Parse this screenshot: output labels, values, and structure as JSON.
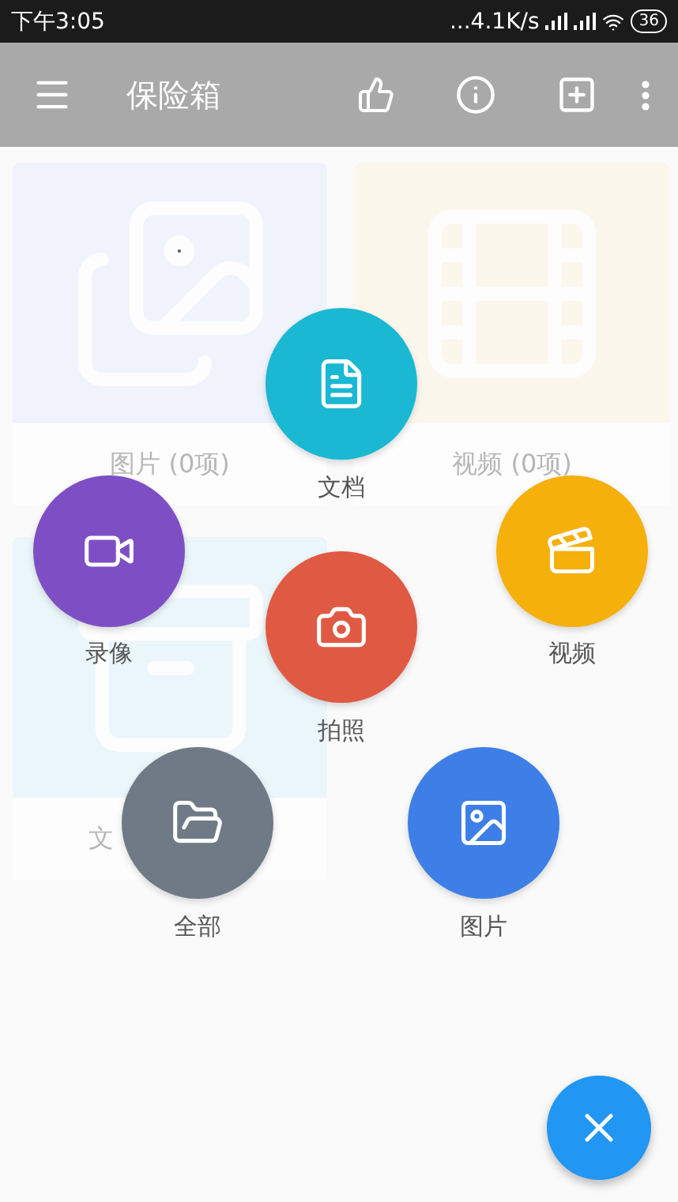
{
  "status_bar": {
    "time": "下午3:05",
    "network_speed": "...4.1K/s",
    "battery": "36"
  },
  "app_bar": {
    "title": "保险箱"
  },
  "cards": [
    {
      "label": "图片 (0项)",
      "color": "#e9effc"
    },
    {
      "label": "视频 (0项)",
      "color": "#fdf6e4"
    },
    {
      "label": "文",
      "color": "#e2f4fa"
    }
  ],
  "menu_items": [
    {
      "label": "文档",
      "color": "#1ab8d3"
    },
    {
      "label": "录像",
      "color": "#7e4fc4"
    },
    {
      "label": "视频",
      "color": "#f5b00c"
    },
    {
      "label": "拍照",
      "color": "#e05a43"
    },
    {
      "label": "全部",
      "color": "#6f7a86"
    },
    {
      "label": "图片",
      "color": "#3d7fe6"
    }
  ],
  "fab": {
    "expanded": true
  }
}
